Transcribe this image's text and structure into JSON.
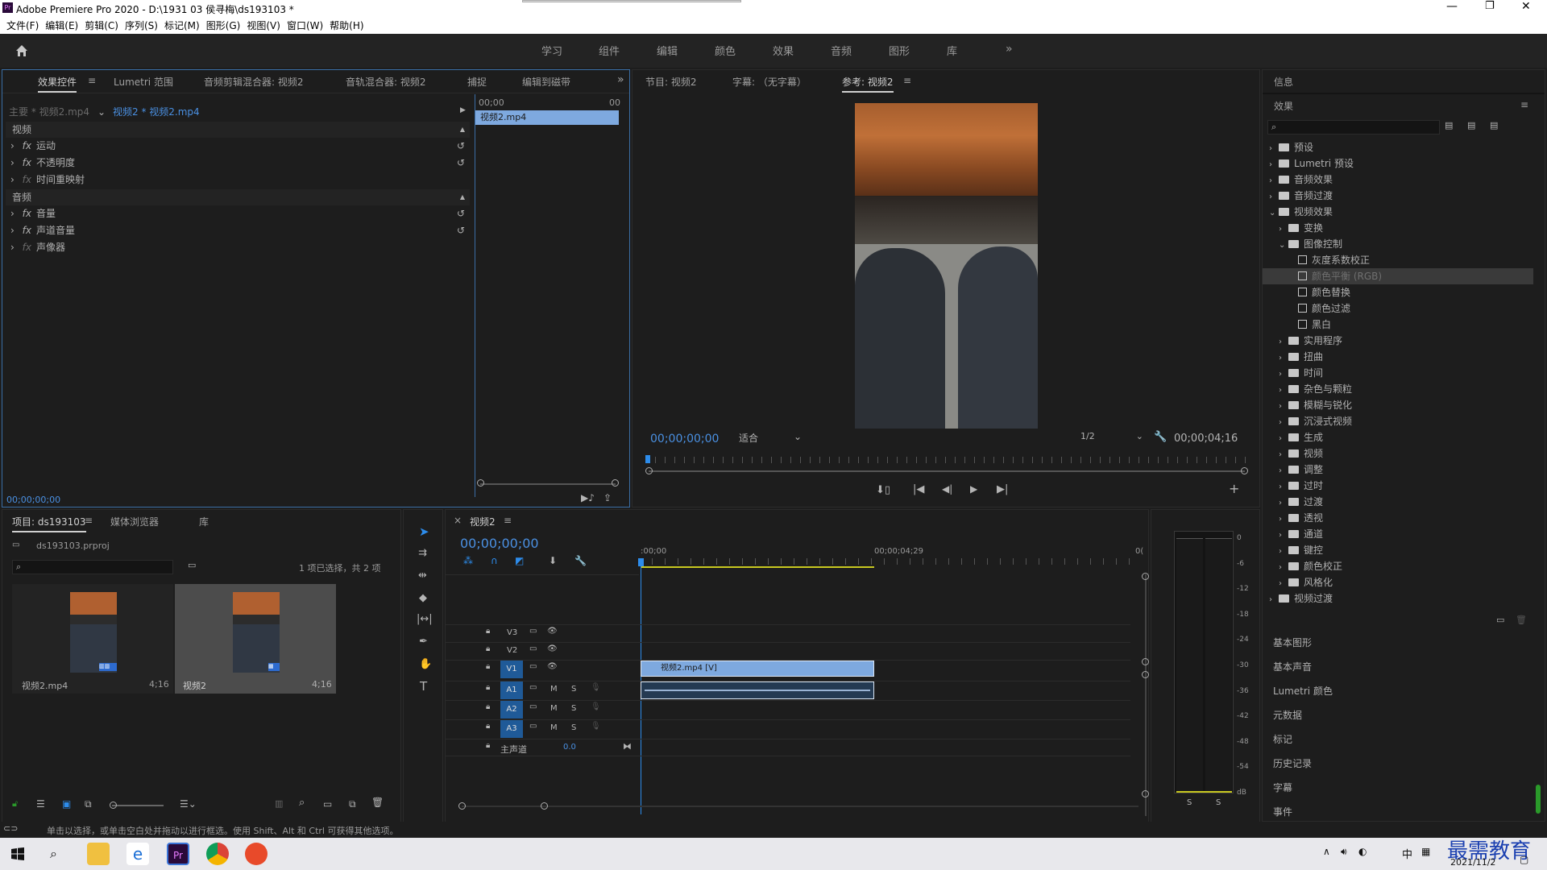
{
  "app": {
    "title": "Adobe Premiere Pro 2020 - D:\\1931 03 侯寻梅\\ds193103 *",
    "icon": "Pr"
  },
  "menu": [
    "文件(F)",
    "编辑(E)",
    "剪辑(C)",
    "序列(S)",
    "标记(M)",
    "图形(G)",
    "视图(V)",
    "窗口(W)",
    "帮助(H)"
  ],
  "workspaces": [
    "学习",
    "组件",
    "编辑",
    "颜色",
    "效果",
    "音频",
    "图形",
    "库"
  ],
  "effect_controls": {
    "tabs": [
      "效果控件",
      "Lumetri 范围",
      "音频剪辑混合器: 视频2",
      "音轨混合器: 视频2",
      "捕捉",
      "编辑到磁带"
    ],
    "source": "主要 * 视频2.mp4",
    "sequence": "视频2 * 视频2.mp4",
    "time_start": "00;00",
    "time_end": "00",
    "clip": "视频2.mp4",
    "video_label": "视频",
    "audio_label": "音频",
    "video_effects": [
      "运动",
      "不透明度",
      "时间重映射"
    ],
    "audio_effects": [
      "音量",
      "声道音量",
      "声像器"
    ],
    "timecode": "00;00;00;00"
  },
  "program": {
    "tabs": [
      "节目: 视频2",
      "字幕: （无字幕）",
      "参考: 视频2"
    ],
    "timecode": "00;00;00;00",
    "fit": "适合",
    "resolution": "1/2",
    "duration": "00;00;04;16"
  },
  "project": {
    "tabs": [
      "项目: ds193103",
      "媒体浏览器",
      "库"
    ],
    "file": "ds193103.prproj",
    "selection": "1 项已选择，共 2 项",
    "items": [
      {
        "name": "视频2.mp4",
        "dur": "4;16"
      },
      {
        "name": "视频2",
        "dur": "4;16"
      }
    ]
  },
  "timeline": {
    "tab": "视频2",
    "timecode": "00;00;00;00",
    "ruler_start": ":00;00",
    "ruler_mid": "00;00;04;29",
    "ruler_end": "0(",
    "video_tracks": [
      "V3",
      "V2",
      "V1"
    ],
    "audio_tracks": [
      "A1",
      "A2",
      "A3"
    ],
    "master": "主声道",
    "master_val": "0.0",
    "clip_label": "视频2.mp4 [V]"
  },
  "meter": {
    "ticks": [
      "0",
      "-6",
      "-12",
      "-18",
      "-24",
      "-30",
      "-36",
      "-42",
      "-48",
      "-54",
      "dB"
    ],
    "solo": [
      "S",
      "S"
    ]
  },
  "effects": {
    "info": "信息",
    "title": "效果",
    "tree": [
      {
        "label": "预设",
        "lvl": 0,
        "t": "f",
        "exp": false
      },
      {
        "label": "Lumetri 预设",
        "lvl": 0,
        "t": "f",
        "exp": false
      },
      {
        "label": "音频效果",
        "lvl": 0,
        "t": "f",
        "exp": false
      },
      {
        "label": "音频过渡",
        "lvl": 0,
        "t": "f",
        "exp": false
      },
      {
        "label": "视频效果",
        "lvl": 0,
        "t": "f",
        "exp": true
      },
      {
        "label": "变换",
        "lvl": 1,
        "t": "f",
        "exp": false
      },
      {
        "label": "图像控制",
        "lvl": 1,
        "t": "f",
        "exp": true
      },
      {
        "label": "灰度系数校正",
        "lvl": 2,
        "t": "e"
      },
      {
        "label": "颜色平衡 (RGB)",
        "lvl": 2,
        "t": "e",
        "sel": true
      },
      {
        "label": "颜色替换",
        "lvl": 2,
        "t": "e"
      },
      {
        "label": "颜色过滤",
        "lvl": 2,
        "t": "e"
      },
      {
        "label": "黑白",
        "lvl": 2,
        "t": "e"
      },
      {
        "label": "实用程序",
        "lvl": 1,
        "t": "f",
        "exp": false
      },
      {
        "label": "扭曲",
        "lvl": 1,
        "t": "f",
        "exp": false
      },
      {
        "label": "时间",
        "lvl": 1,
        "t": "f",
        "exp": false
      },
      {
        "label": "杂色与颗粒",
        "lvl": 1,
        "t": "f",
        "exp": false
      },
      {
        "label": "模糊与锐化",
        "lvl": 1,
        "t": "f",
        "exp": false
      },
      {
        "label": "沉浸式视频",
        "lvl": 1,
        "t": "f",
        "exp": false
      },
      {
        "label": "生成",
        "lvl": 1,
        "t": "f",
        "exp": false
      },
      {
        "label": "视频",
        "lvl": 1,
        "t": "f",
        "exp": false
      },
      {
        "label": "调整",
        "lvl": 1,
        "t": "f",
        "exp": false
      },
      {
        "label": "过时",
        "lvl": 1,
        "t": "f",
        "exp": false
      },
      {
        "label": "过渡",
        "lvl": 1,
        "t": "f",
        "exp": false
      },
      {
        "label": "透视",
        "lvl": 1,
        "t": "f",
        "exp": false
      },
      {
        "label": "通道",
        "lvl": 1,
        "t": "f",
        "exp": false
      },
      {
        "label": "键控",
        "lvl": 1,
        "t": "f",
        "exp": false
      },
      {
        "label": "颜色校正",
        "lvl": 1,
        "t": "f",
        "exp": false
      },
      {
        "label": "风格化",
        "lvl": 1,
        "t": "f",
        "exp": false
      },
      {
        "label": "视频过渡",
        "lvl": 0,
        "t": "f",
        "exp": false
      }
    ],
    "sections": [
      "基本图形",
      "基本声音",
      "Lumetri 颜色",
      "元数据",
      "标记",
      "历史记录",
      "字幕",
      "事件"
    ]
  },
  "status": "单击以选择，或单击空白处并拖动以进行框选。使用 Shift、Alt 和 Ctrl 可获得其他选项。",
  "taskbar": {
    "date": "2021/11/2",
    "ime": "中",
    "watermark": "最需教育"
  }
}
